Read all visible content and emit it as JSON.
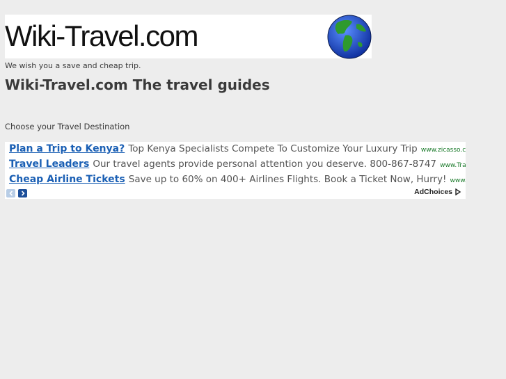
{
  "banner": {
    "logo_text": "Wiki-Travel.com",
    "globe_icon": "globe-icon"
  },
  "tagline": "We wish you a save and cheap trip.",
  "headline": "Wiki-Travel.com The travel guides",
  "choose_text": "Choose your Travel Destination",
  "ads": [
    {
      "title": "Plan a Trip to Kenya?",
      "description": "Top Kenya Specialists Compete To Customize Your Luxury Trip",
      "url": "www.zicasso.com"
    },
    {
      "title": "Travel Leaders",
      "description": "Our travel agents provide personal attention you deserve. 800-867-8747",
      "url": "www.TravelLeade..."
    },
    {
      "title": "Cheap Airline Tickets",
      "description": "Save up to 60% on 400+ Airlines Flights. Book a Ticket Now, Hurry!",
      "url": "www.OneTrave..."
    }
  ],
  "ad_nav": {
    "prev_icon": "chevron-left-icon",
    "next_icon": "chevron-right-icon"
  },
  "adchoices_label": "AdChoices",
  "colors": {
    "background": "#ededed",
    "ad_link": "#1a5fb4",
    "ad_url": "#1a7a2a",
    "text": "#3a3a3a"
  }
}
